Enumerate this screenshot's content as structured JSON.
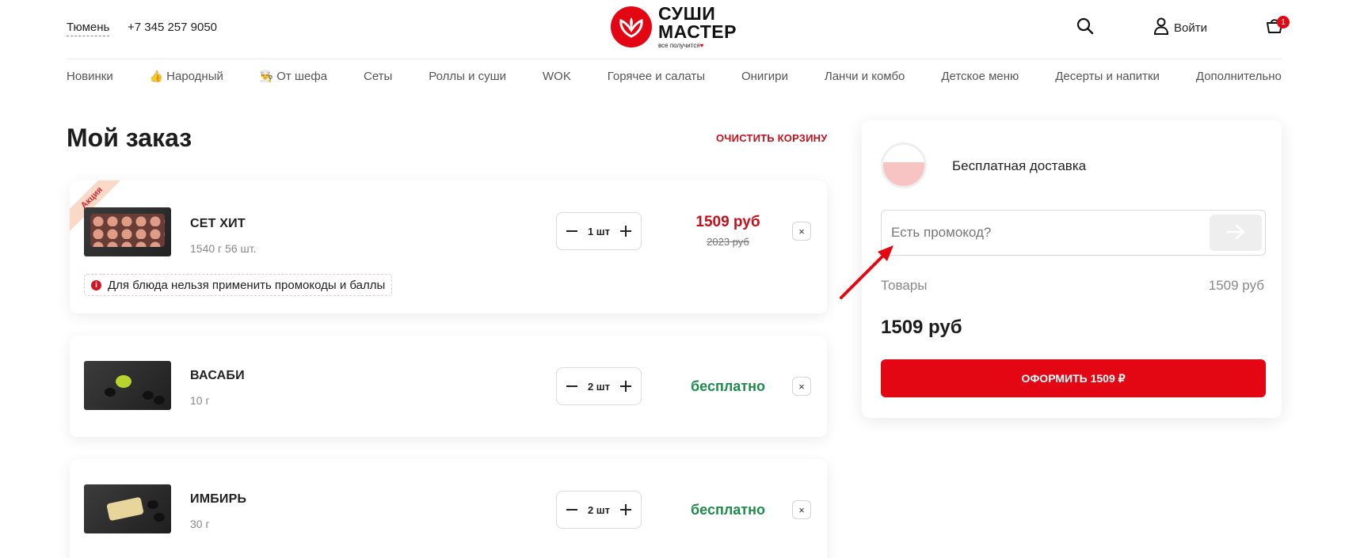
{
  "header": {
    "city": "Тюмень",
    "phone": "+7 345 257 9050",
    "logo": {
      "line1": "СУШИ",
      "line2": "МАСТЕР",
      "slogan": "все получится"
    },
    "login_label": "Войти",
    "cart_count": "1",
    "icons": {
      "search": "search-icon",
      "user": "user-icon",
      "cart": "cart-icon"
    }
  },
  "nav": {
    "items": [
      {
        "label": "Новинки",
        "emoji": ""
      },
      {
        "label": "Народный",
        "emoji": "👍"
      },
      {
        "label": "От шефа",
        "emoji": "👨‍🍳"
      },
      {
        "label": "Сеты",
        "emoji": ""
      },
      {
        "label": "Роллы и суши",
        "emoji": ""
      },
      {
        "label": "WOK",
        "emoji": ""
      },
      {
        "label": "Горячее и салаты",
        "emoji": ""
      },
      {
        "label": "Онигири",
        "emoji": ""
      },
      {
        "label": "Ланчи и комбо",
        "emoji": ""
      },
      {
        "label": "Детское меню",
        "emoji": ""
      },
      {
        "label": "Десерты и напитки",
        "emoji": ""
      },
      {
        "label": "Дополнительно",
        "emoji": ""
      }
    ]
  },
  "order": {
    "title": "Мой заказ",
    "clear_label": "ОЧИСТИТЬ КОРЗИНУ",
    "items": [
      {
        "badge": "Акция",
        "name": "СЕТ ХИТ",
        "weight": "1540 г 56 шт.",
        "qty": "1 шт",
        "price": "1509 руб",
        "old_price": "2023 руб",
        "remove": "×",
        "warning": "Для блюда нельзя применить промокоды и баллы"
      },
      {
        "name": "ВАСАБИ",
        "weight": "10 г",
        "qty": "2 шт",
        "price": "бесплатно",
        "remove": "×"
      },
      {
        "name": "ИМБИРЬ",
        "weight": "30 г",
        "qty": "2 шт",
        "price": "бесплатно",
        "remove": "×"
      }
    ]
  },
  "summary": {
    "delivery_label": "Бесплатная доставка",
    "delivery_progress_fraction": 0.58,
    "promo_placeholder": "Есть промокод?",
    "goods_label": "Товары",
    "goods_value": "1509 руб",
    "total": "1509 руб",
    "checkout_label": "ОФОРМИТЬ 1509 ₽"
  },
  "colors": {
    "accent": "#e30613",
    "price_red": "#c4101c",
    "free_green": "#1f8a4c"
  }
}
